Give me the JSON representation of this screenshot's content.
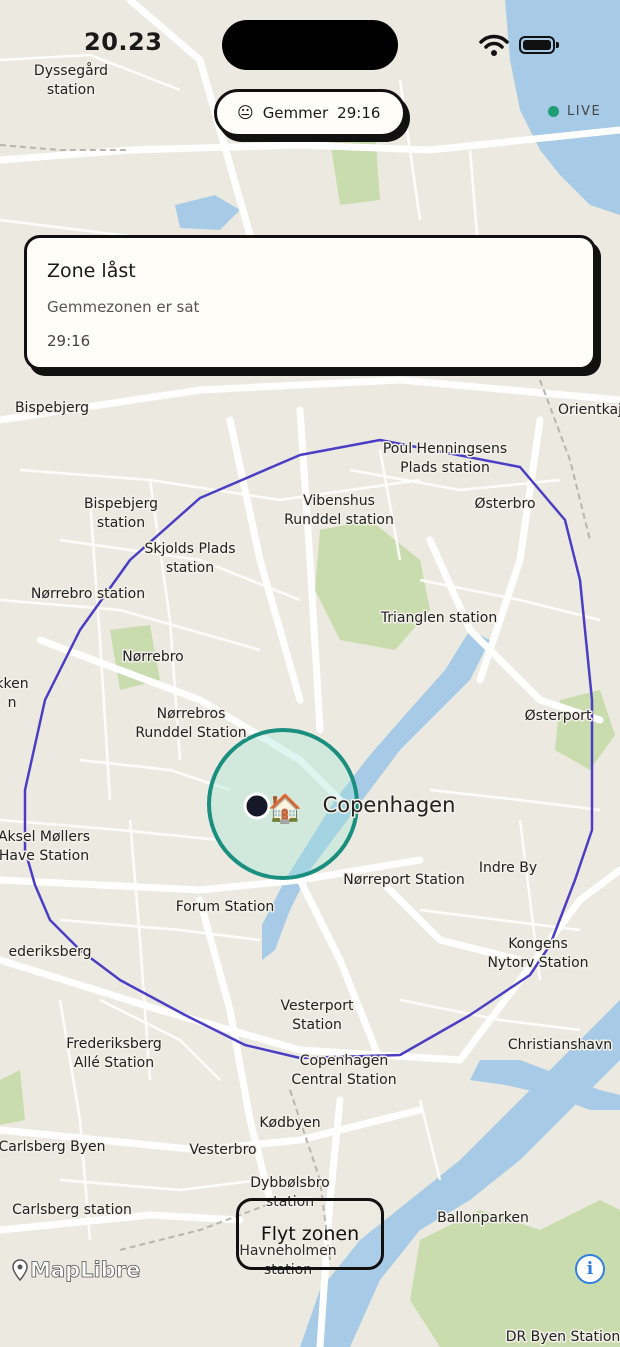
{
  "status_bar": {
    "time": "20.23"
  },
  "timer_pill": {
    "label": "Gemmer",
    "time": "29:16",
    "face_icon": "neutral-face-icon"
  },
  "live_indicator": {
    "label": "LIVE",
    "color": "#1f9d74"
  },
  "zone_card": {
    "title": "Zone låst",
    "subtitle": "Gemmezonen er sat",
    "time": "29:16"
  },
  "map": {
    "zone_color": "#4a3fc4",
    "local_zone_color": "#1a8f7f",
    "water_color": "#a7cbe6",
    "park_color": "#c9dcae",
    "home_marker": "🏠",
    "labels": [
      "Dyssegård\nstation",
      "Bispebjerg",
      "Orientkaj",
      "Poul Henningsens\nPlads station",
      "Bispebjerg\nstation",
      "Vibenshus\nRunddel station",
      "Østerbro",
      "Skjolds Plads\nstation",
      "Nørrebro station",
      "Trianglen station",
      "Nørrebro",
      "kken\nn",
      "Nørrebros\nRunddel Station",
      "Østerport",
      "Copenhagen",
      "Aksel Møllers\nHave Station",
      "Nørreport Station",
      "Indre By",
      "Forum Station",
      "ederiksberg",
      "Kongens\nNytorv Station",
      "Vesterport\nStation",
      "Frederiksberg\nAllé Station",
      "Copenhagen\nCentral Station",
      "Christianshavn",
      "Kødbyen",
      "Carlsberg Byen",
      "Vesterbro",
      "Dybbølsbro\nstation",
      "Carlsberg station",
      "Ballonparken",
      "Havneholmen\nstation",
      "DR Byen Station"
    ]
  },
  "move_button": {
    "label": "Flyt zonen"
  },
  "attribution": {
    "label": "MapLibre"
  },
  "info_button": {
    "label": "i"
  }
}
